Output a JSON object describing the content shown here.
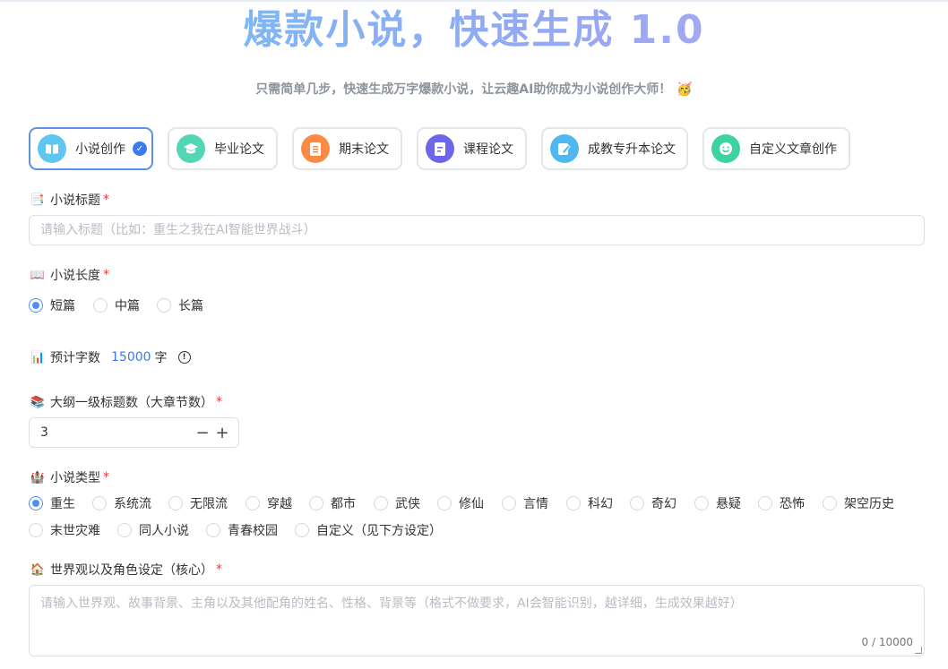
{
  "hero": {
    "title": "爆款小说，快速生成 1.0",
    "subtitle": "只需简单几步，快速生成万字爆款小说，让云趣AI助你成为小说创作大师！",
    "subtitle_emoji": "🥳"
  },
  "tabs": [
    {
      "label": "小说创作",
      "icon": "book-icon",
      "color": "#5fc6f3"
    },
    {
      "label": "毕业论文",
      "icon": "graduation-cap-icon",
      "color": "#52d6b4"
    },
    {
      "label": "期末论文",
      "icon": "document-icon",
      "color": "#fb8a45"
    },
    {
      "label": "课程论文",
      "icon": "notes-icon",
      "color": "#6e66e8"
    },
    {
      "label": "成教专升本论文",
      "icon": "edit-icon",
      "color": "#4fb8f0"
    },
    {
      "label": "自定义文章创作",
      "icon": "smile-icon",
      "color": "#3dd29e"
    }
  ],
  "fields": {
    "title": {
      "label": "小说标题",
      "icon": "📑",
      "placeholder": "请输入标题（比如：重生之我在AI智能世界战斗）"
    },
    "length": {
      "label": "小说长度",
      "icon": "📖",
      "options": [
        "短篇",
        "中篇",
        "长篇"
      ],
      "selected": "短篇"
    },
    "estimate": {
      "label": "预计字数",
      "icon": "📊",
      "value": "15000",
      "unit": "字",
      "info_icon": "info-icon"
    },
    "outline": {
      "label": "大纲一级标题数（大章节数）",
      "icon": "📚",
      "value": "3",
      "minus": "−",
      "plus": "+"
    },
    "genre": {
      "label": "小说类型",
      "icon": "🏰",
      "options": [
        "重生",
        "系统流",
        "无限流",
        "穿越",
        "都市",
        "武侠",
        "修仙",
        "言情",
        "科幻",
        "奇幻",
        "悬疑",
        "恐怖",
        "架空历史",
        "末世灾难",
        "同人小说",
        "青春校园",
        "自定义（见下方设定）"
      ],
      "selected": "重生"
    },
    "world": {
      "label": "世界观以及角色设定（核心）",
      "icon": "🏠",
      "placeholder": "请输入世界观、故事背景、主角以及其他配角的姓名、性格、背景等（格式不做要求，AI会智能识别，越详细，生成效果越好）",
      "count": "0 / 10000"
    }
  },
  "required_mark": "*",
  "colors": {
    "accent": "#3b7bf0",
    "required": "#e53b3b"
  }
}
